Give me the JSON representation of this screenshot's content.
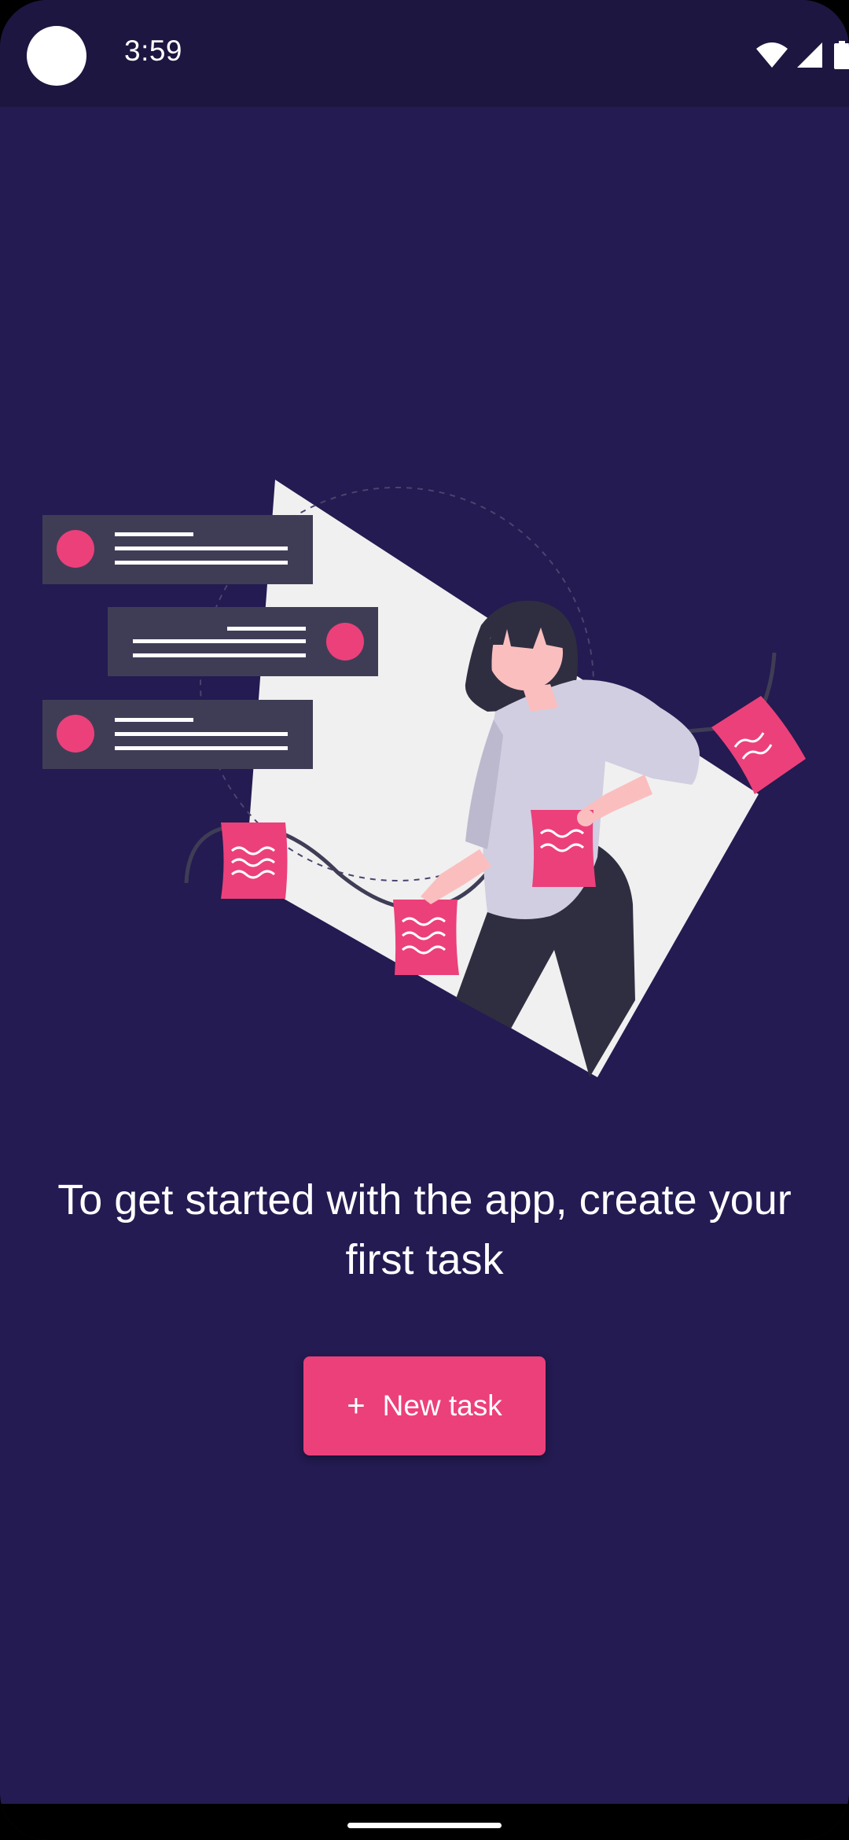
{
  "status_bar": {
    "time": "3:59",
    "icons": [
      "wifi-icon",
      "cellular-signal-icon",
      "battery-icon"
    ]
  },
  "empty_state": {
    "illustration": "woman-with-task-notes-illustration",
    "message": "To get started with the app, create your first task"
  },
  "new_task_button": {
    "icon": "plus-icon",
    "icon_glyph": "+",
    "label": "New task"
  },
  "colors": {
    "background": "#231b51",
    "status_bar": "#1c1640",
    "accent": "#ec407a",
    "card": "#3f3d56",
    "panel": "#f0f0f0"
  }
}
